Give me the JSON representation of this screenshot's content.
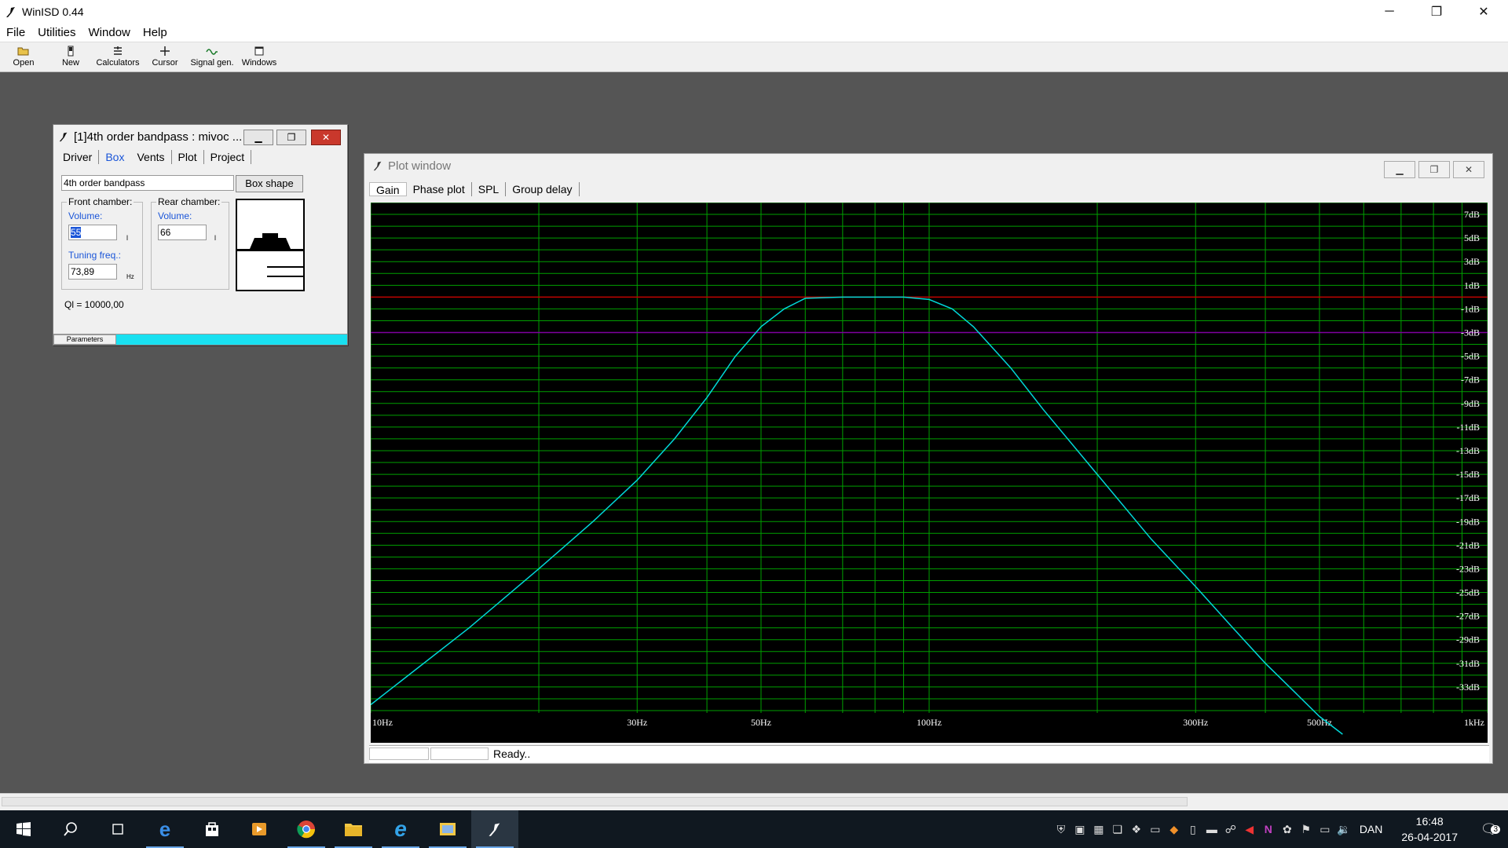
{
  "app": {
    "title": "WinISD 0.44",
    "window_controls": {
      "minimize": "─",
      "maximize": "❐",
      "close": "✕"
    }
  },
  "menu": [
    "File",
    "Utilities",
    "Window",
    "Help"
  ],
  "toolbar": [
    "Open",
    "New",
    "Calculators",
    "Cursor",
    "Signal gen.",
    "Windows"
  ],
  "box_window": {
    "title": "[1]4th order bandpass : mivoc ...",
    "tabs": [
      "Driver",
      "Box",
      "Vents",
      "Plot",
      "Project"
    ],
    "active_tab": "Box",
    "box_type": "4th order bandpass",
    "box_shape_button": "Box shape",
    "front_chamber": {
      "label": "Front chamber:",
      "volume_label": "Volume:",
      "volume": "55",
      "volume_unit": "l",
      "tuning_label": "Tuning freq.:",
      "tuning": "73,89",
      "tuning_unit": "Hz"
    },
    "rear_chamber": {
      "label": "Rear chamber:",
      "volume_label": "Volume:",
      "volume": "66",
      "volume_unit": "l"
    },
    "ql": "Ql = 10000,00",
    "status_tab": "Parameters"
  },
  "plot_window": {
    "title": "Plot window",
    "tabs": [
      "Gain",
      "Phase plot",
      "SPL",
      "Group delay"
    ],
    "active_tab": "Gain",
    "status": "Ready.."
  },
  "chart_data": {
    "type": "line",
    "xscale": "log",
    "xlim": [
      10,
      1000
    ],
    "ylim": [
      -35,
      8
    ],
    "x_tick_labels": [
      "10Hz",
      "30Hz",
      "50Hz",
      "100Hz",
      "300Hz",
      "500Hz",
      "1kHz"
    ],
    "x_ticks": [
      10,
      30,
      50,
      100,
      300,
      500,
      1000
    ],
    "y_tick_labels": [
      "7dB",
      "5dB",
      "3dB",
      "1dB",
      "-1dB",
      "-3dB",
      "-5dB",
      "-7dB",
      "-9dB",
      "-11dB",
      "-13dB",
      "-15dB",
      "-17dB",
      "-19dB",
      "-21dB",
      "-23dB",
      "-25dB",
      "-27dB",
      "-29dB",
      "-31dB",
      "-33dB"
    ],
    "y_ticks": [
      7,
      5,
      3,
      1,
      -1,
      -3,
      -5,
      -7,
      -9,
      -11,
      -13,
      -15,
      -17,
      -19,
      -21,
      -23,
      -25,
      -27,
      -29,
      -31,
      -33
    ],
    "reference_lines": [
      {
        "y": 0,
        "color": "#c00000"
      },
      {
        "y": -3,
        "color": "#8000a0"
      }
    ],
    "grid": true,
    "background": "#000000",
    "grid_color": "#00a000",
    "series": [
      {
        "color": "#00d8d8",
        "x": [
          10,
          15,
          20,
          25,
          30,
          35,
          40,
          45,
          50,
          55,
          60,
          70,
          80,
          90,
          100,
          110,
          120,
          140,
          160,
          200,
          250,
          300,
          350,
          400,
          500,
          550
        ],
        "y": [
          -34.5,
          -28,
          -23,
          -19,
          -15.5,
          -12,
          -8.5,
          -5,
          -2.5,
          -1,
          -0.1,
          0,
          0,
          0,
          -0.2,
          -1,
          -2.5,
          -6,
          -9.5,
          -15,
          -20.5,
          -24.5,
          -28,
          -31,
          -35.5,
          -37
        ]
      }
    ]
  },
  "taskbar": {
    "clock_time": "16:48",
    "clock_date": "26-04-2017",
    "language": "DAN",
    "notification_count": "3"
  }
}
